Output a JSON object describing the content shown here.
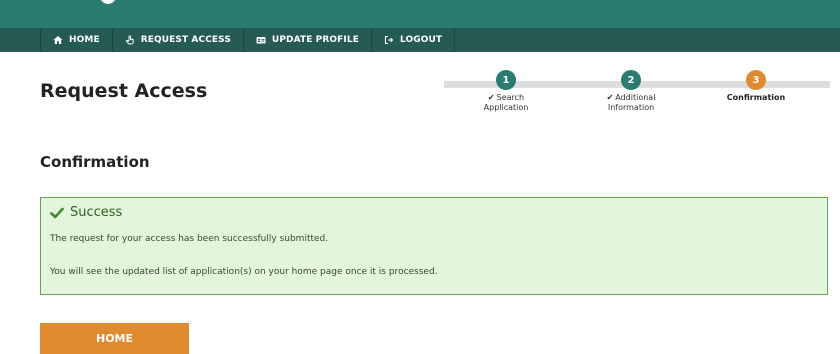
{
  "colors": {
    "header": "#2a7c70",
    "nav": "#255b54",
    "accent_orange": "#e08a2e",
    "success_bg": "#e4f5dd",
    "success_border": "#63a94b"
  },
  "nav": [
    {
      "label": "HOME",
      "icon": "home-icon"
    },
    {
      "label": "REQUEST ACCESS",
      "icon": "hand-pointer-icon"
    },
    {
      "label": "UPDATE PROFILE",
      "icon": "id-card-icon"
    },
    {
      "label": "LOGOUT",
      "icon": "sign-out-icon"
    }
  ],
  "page": {
    "title": "Request Access",
    "section_title": "Confirmation"
  },
  "stepper": {
    "steps": [
      {
        "number": "1",
        "label_line1": "Search",
        "label_line2": "Application",
        "status": "completed"
      },
      {
        "number": "2",
        "label_line1": "Additional",
        "label_line2": "Information",
        "status": "completed"
      },
      {
        "number": "3",
        "label_line1": "Confirmation",
        "label_line2": "",
        "status": "current"
      }
    ]
  },
  "alert": {
    "title": "Success",
    "line1": "The request for your access has been successfully submitted.",
    "line2": "You will see the updated list of application(s) on your home page once it is processed."
  },
  "buttons": {
    "home": "HOME"
  }
}
